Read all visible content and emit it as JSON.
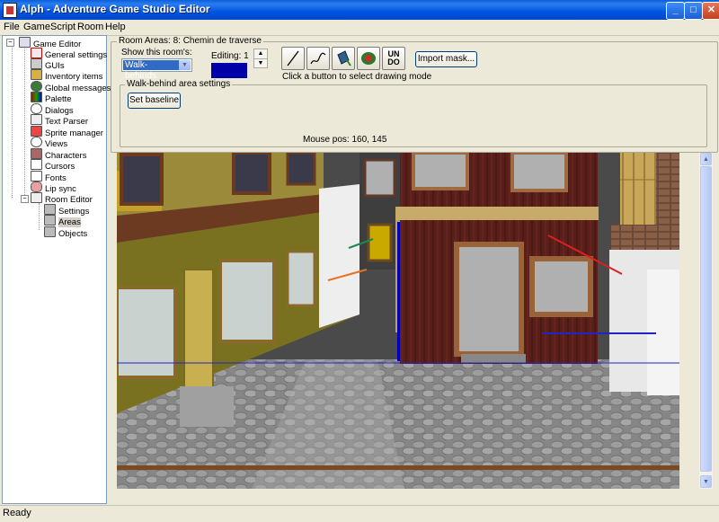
{
  "window": {
    "title": "Alph - Adventure Game Studio Editor",
    "btn_min": "_",
    "btn_max": "□",
    "btn_close": "✕"
  },
  "menu": [
    "File",
    "Game",
    "Script",
    "Room",
    "Help"
  ],
  "tree": {
    "root": "Game Editor",
    "items": [
      "General settings",
      "GUIs",
      "Inventory items",
      "Global messages",
      "Palette",
      "Dialogs",
      "Text Parser",
      "Sprite manager",
      "Views",
      "Characters",
      "Cursors",
      "Fonts",
      "Lip sync"
    ],
    "room_editor": "Room Editor",
    "room_items": [
      "Settings",
      "Areas",
      "Objects"
    ],
    "expand_sign": "−"
  },
  "panel": {
    "group_title": "Room Areas: 8: Chemin de traverse",
    "show_label": "Show this room's:",
    "show_value": "Walk-behinds",
    "editing_label": "Editing: 1",
    "editing_color": "#0000a8",
    "tool_hint": "Click a button to select drawing mode",
    "undo_label": "UN\nDO",
    "import_mask": "Import mask...",
    "walkbehind_title": "Walk-behind area settings",
    "set_baseline": "Set baseline",
    "mouse_pos": "Mouse pos: 160, 145"
  },
  "icons": {
    "line_tool": "line-tool-icon",
    "freehand_tool": "freehand-tool-icon",
    "fill_tool": "fill-tool-icon",
    "eraser_tool": "eraser-tool-icon"
  },
  "status": "Ready"
}
